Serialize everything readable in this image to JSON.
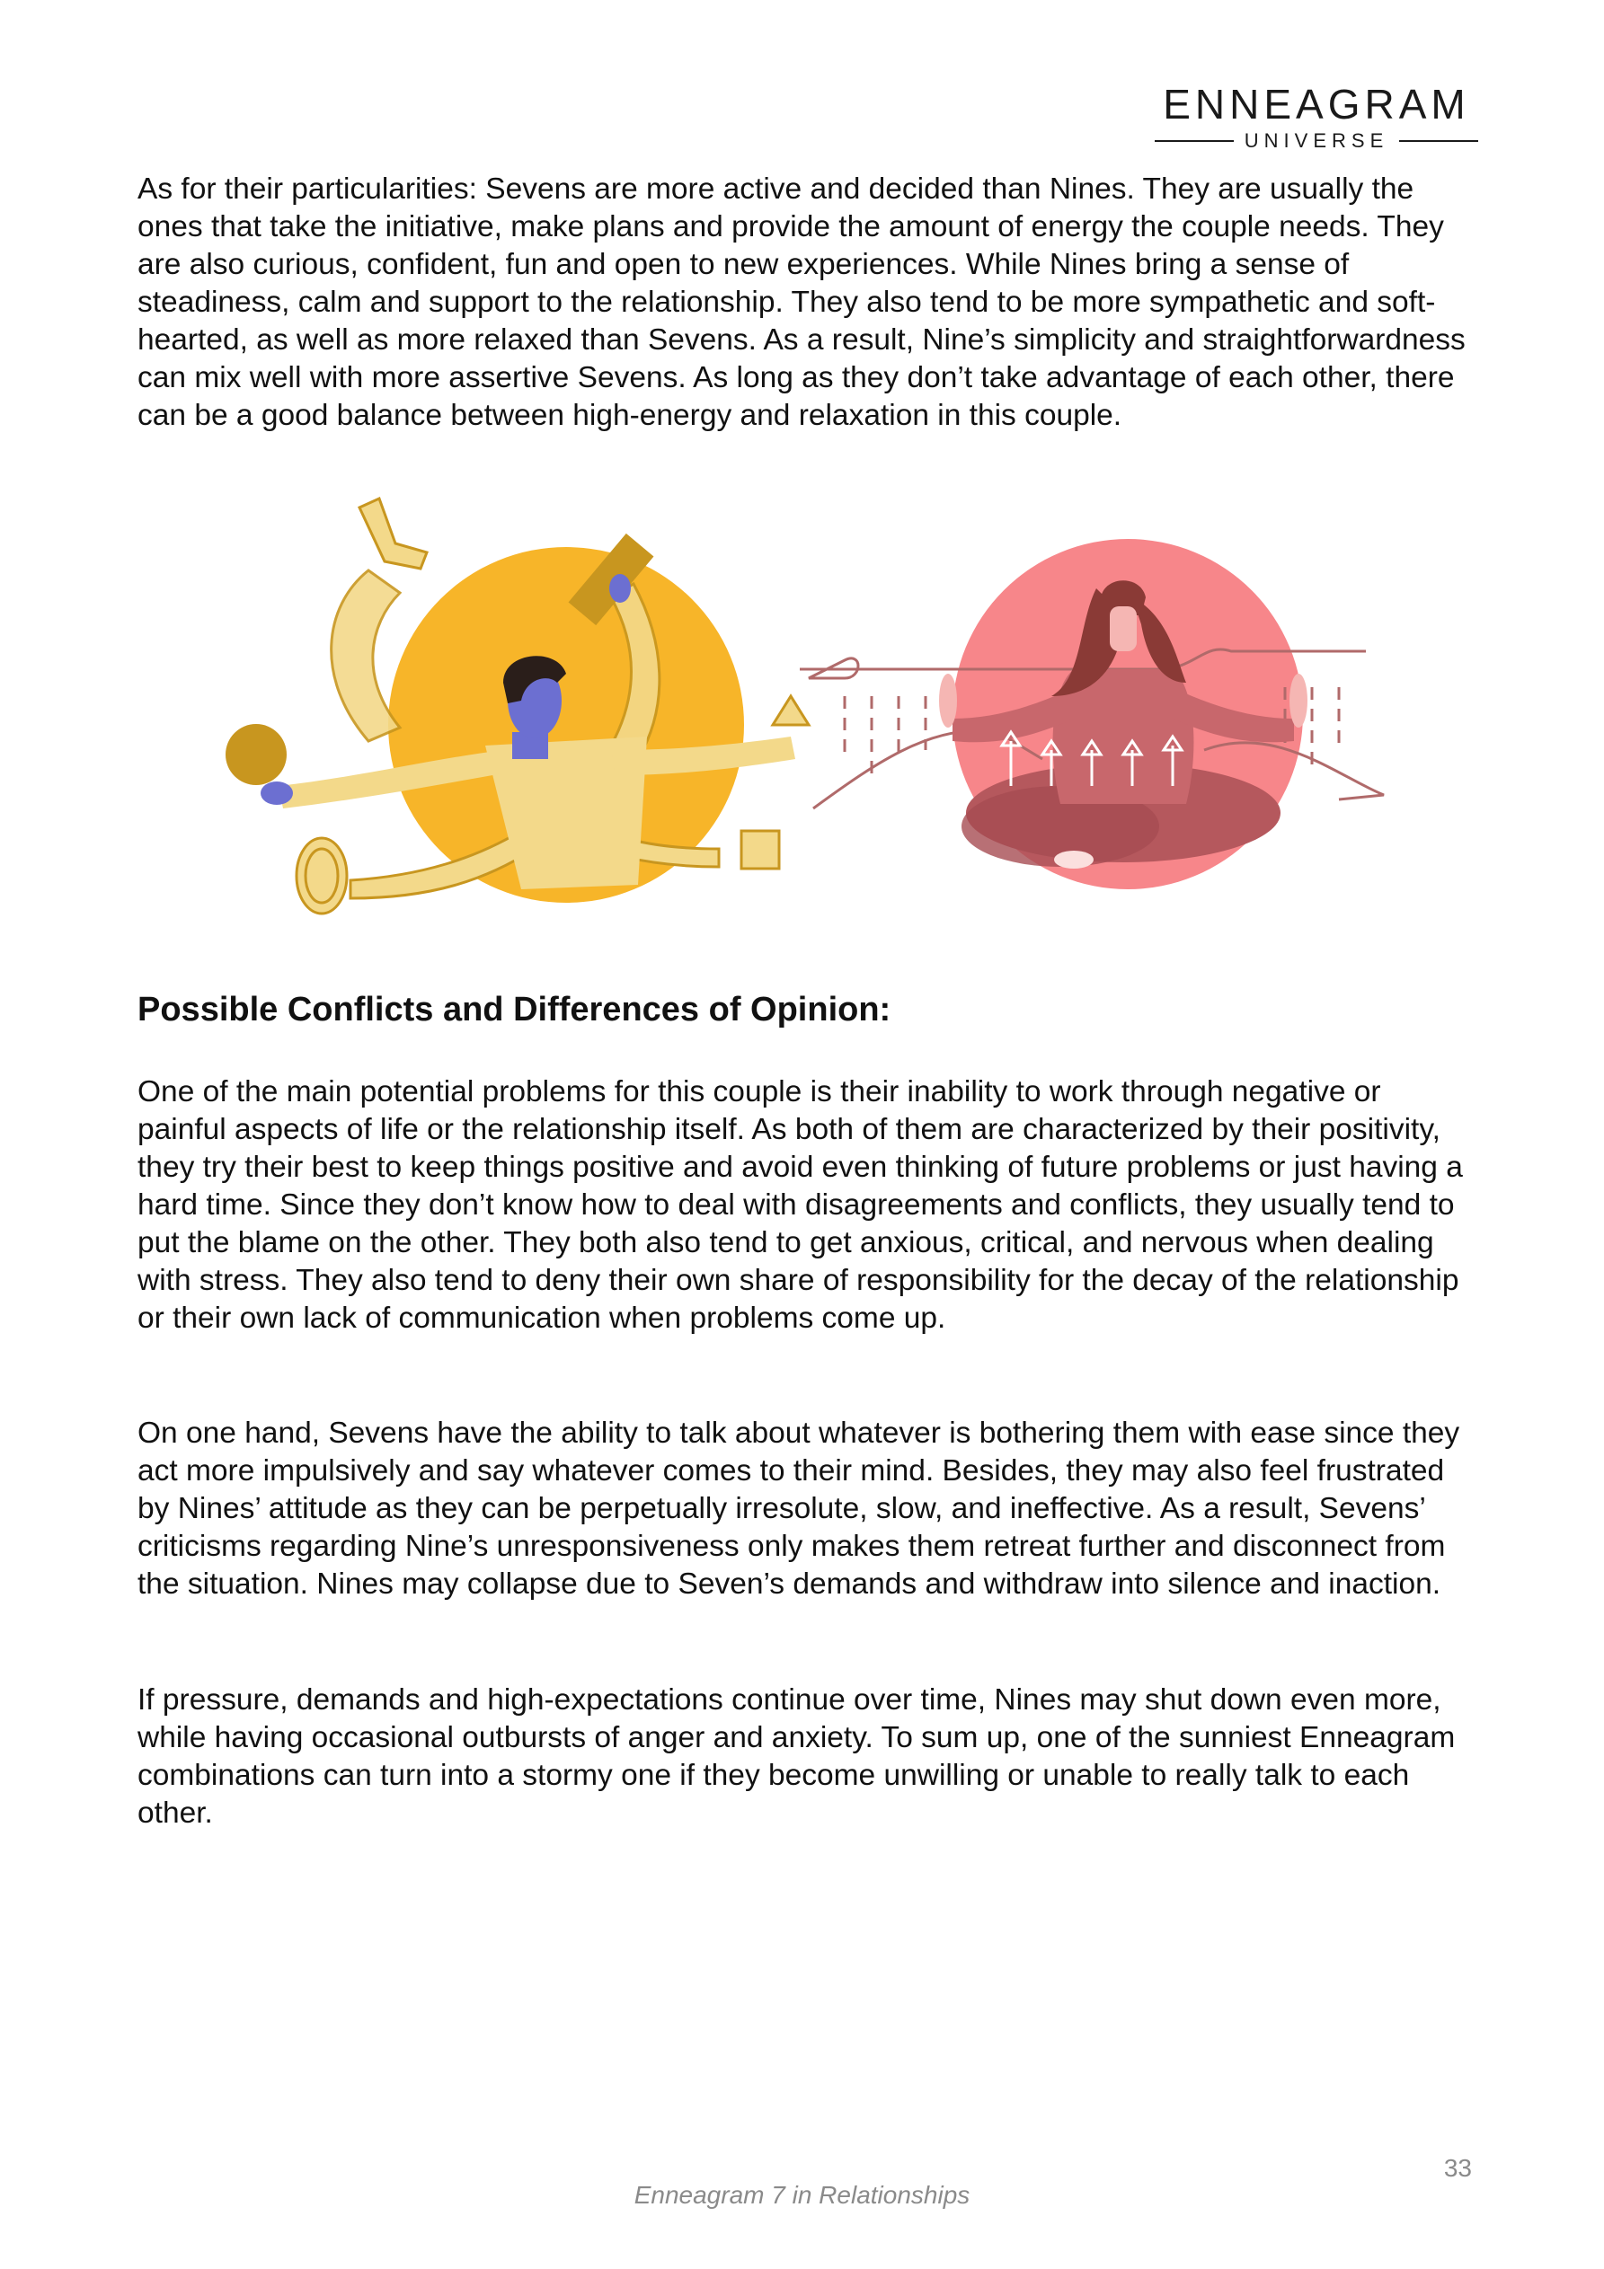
{
  "logo": {
    "title": "ENNEAGRAM",
    "subtitle": "UNIVERSE"
  },
  "paragraphs": {
    "p1": "As for their particularities: Sevens are more active and decided than Nines. They are usually the ones that take the initiative, make plans and provide the amount of energy the couple needs. They are also curious, confident, fun and open to new experiences. While Nines bring a sense of steadiness, calm and support to the relationship. They also tend to be more sympathetic and soft-hearted, as well as more relaxed than Sevens. As a result, Nine’s simplicity and straightforwardness can mix well with more assertive Sevens. As long as they don’t take advantage of each other, there can be a good balance between high-energy and relaxation in this couple.",
    "p2": "One of the main potential problems for this couple is their inability to work through negative or painful aspects of life or the relationship itself. As both of them are characterized by their positivity, they try their best to keep things positive and avoid even thinking of future problems or just having a hard time. Since they don’t know how to deal with disagreements and conflicts, they usually tend to put the blame on the other. They both also tend to get anxious, critical, and nervous when dealing with stress. They also tend to deny their own share of responsibility for the decay of the relationship or their own lack of communication when problems come up.",
    "p3": "On one hand, Sevens have the ability to talk about whatever is bothering them with ease since they act more impulsively and say whatever comes to their mind. Besides, they may also feel frustrated by Nines’ attitude as they can be perpetually irresolute, slow, and ineffective. As a result, Sevens’ criticisms regarding Nine’s unresponsiveness only makes them retreat further and disconnect from the situation. Nines may collapse due to Seven’s demands and withdraw into silence and inaction.",
    "p4": "If pressure, demands and high-expectations continue over time, Nines may shut down even more, while having occasional outbursts of anger and anxiety. To sum up, one of the sunniest Enneagram combinations can turn into a stormy one if they become unwilling or unable to really talk to each other."
  },
  "heading": "Possible Conflicts and Differences of Opinion:",
  "page_number": "33",
  "footer": "Enneagram 7 in Relationships",
  "colors": {
    "yellow_sun": "#F7B529",
    "mustard": "#C8961F",
    "skin_blue": "#6C6FD1",
    "arm_light": "#F3D98A",
    "pink_circle": "#F7868A",
    "maroon": "#B5585D",
    "hair_brown": "#8A3A36",
    "outline": "#B06A6A"
  },
  "icons": {
    "illustration": "seven-and-nine-couple-illustration"
  }
}
